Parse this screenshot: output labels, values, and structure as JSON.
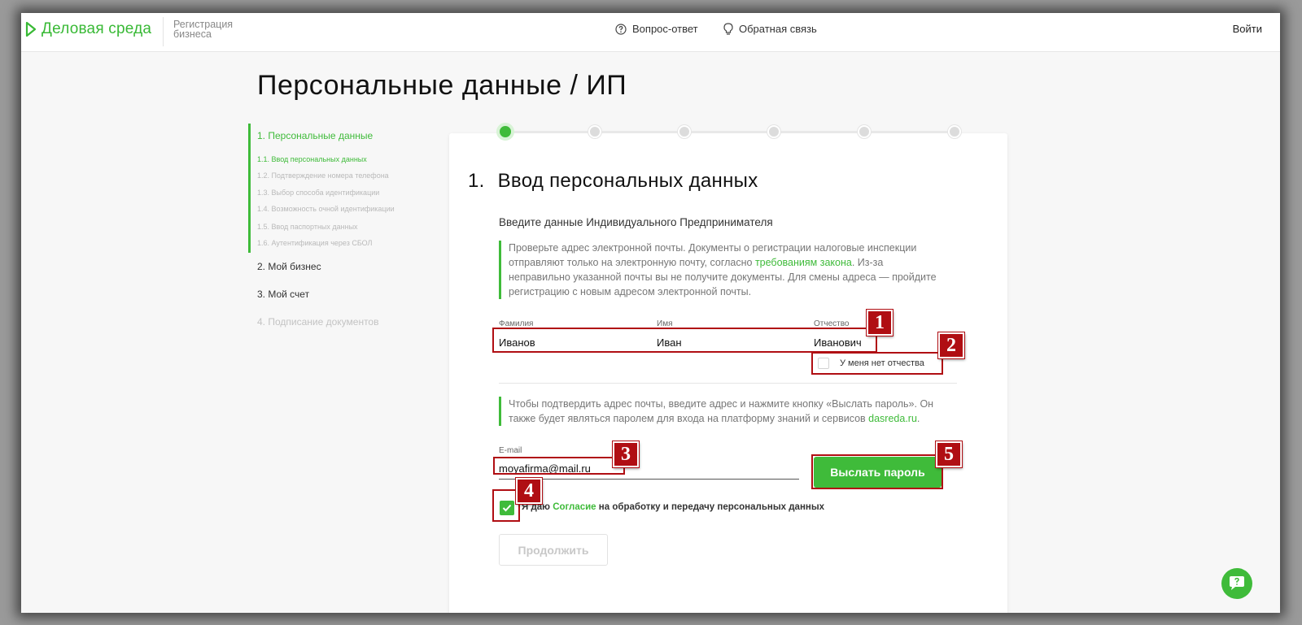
{
  "header": {
    "brand": "Деловая среда",
    "brand_sub": "Регистрация бизнеса",
    "nav_faq": "Вопрос-ответ",
    "nav_feedback": "Обратная связь",
    "login": "Войти"
  },
  "page_title": "Персональные данные / ИП",
  "sidebar": {
    "step1": "1. Персональные данные",
    "substeps": [
      "1.1. Ввод персональных данных",
      "1.2. Подтверждение номера телефона",
      "1.3. Выбор способа идентификации",
      "1.4. Возможность очной идентификации",
      "1.5. Ввод паспортных данных",
      "1.6. Аутентификация через СБОЛ"
    ],
    "step2": "2. Мой бизнес",
    "step3": "3. Мой счет",
    "step4": "4. Подписание документов"
  },
  "stepper": {
    "total": 6,
    "active": 1
  },
  "form": {
    "heading_num": "1.",
    "heading": "Ввод персональных данных",
    "subheading": "Введите данные Индивидуального Предпринимателя",
    "note1_a": "Проверьте адрес электронной почты. Документы о регистрации налоговые инспекции",
    "note1_b": "отправляют только на электронную почту, согласно ",
    "note1_link": "требованиям закона",
    "note1_c": ". Из-за",
    "note1_d": "неправильно указанной почты вы не получите документы. Для смены адреса — пройдите",
    "note1_e": "регистрацию с новым адресом электронной почты.",
    "lastname_label": "Фамилия",
    "lastname_value": "Иванов",
    "firstname_label": "Имя",
    "firstname_value": "Иван",
    "patronymic_label": "Отчество",
    "patronymic_value": "Иванович",
    "no_patronymic": "У меня нет отчества",
    "note2_a": "Чтобы подтвердить адрес почты, введите адрес и нажмите кнопку «Выслать пароль». Он",
    "note2_b": "также будет являться паролем для входа на платформу знаний и сервисов ",
    "note2_link": "dasreda.ru",
    "note2_c": ".",
    "email_label": "E-mail",
    "email_value": "moyafirma@mail.ru",
    "send_password": "Выслать пароль",
    "consent_a": "Я даю ",
    "consent_link": "Согласие",
    "consent_b": " на обработку и передачу персональных данных",
    "consent_checked": true,
    "continue": "Продолжить"
  },
  "annotations": [
    "1",
    "2",
    "3",
    "4",
    "5"
  ],
  "colors": {
    "accent": "#3fbb3a",
    "annotation": "#b00e13"
  }
}
